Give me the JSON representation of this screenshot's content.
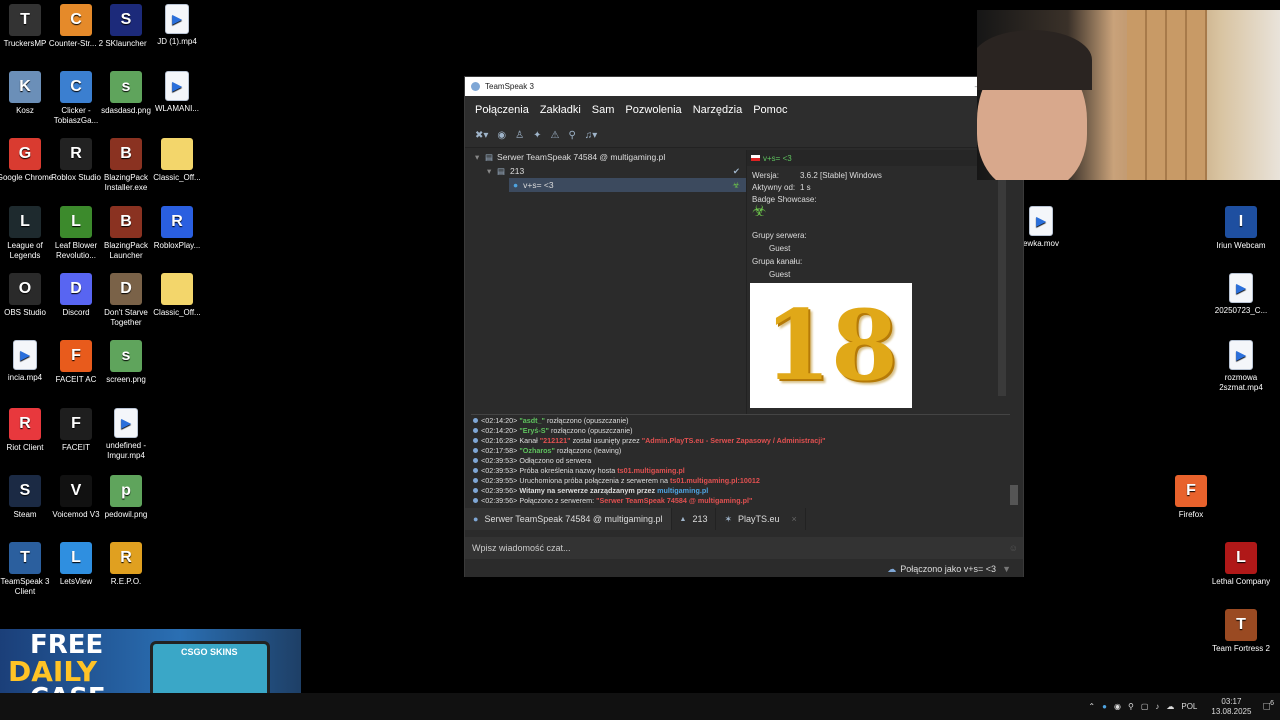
{
  "desktop_icons": [
    {
      "label": "TruckersMP",
      "icon": "truckersmp-icon",
      "color": "#333"
    },
    {
      "label": "Counter-Str... 2",
      "icon": "counter-strike-icon",
      "color": "#e58a2a"
    },
    {
      "label": "SKlauncher",
      "icon": "sklauncher-icon",
      "color": "#1c2a7a"
    },
    {
      "label": "JD (1).mp4",
      "icon": "video-file-icon",
      "color": ""
    },
    {
      "label": "Kosz",
      "icon": "recycle-bin-icon",
      "color": "#6b8fb8"
    },
    {
      "label": "Clicker - TobiaszGa...",
      "icon": "shortcut-icon",
      "color": "#3b7fd0"
    },
    {
      "label": "sdasdasd.png",
      "icon": "image-file-icon",
      "color": "#5fa45c"
    },
    {
      "label": "WLAMANI...",
      "icon": "video-file-icon",
      "color": ""
    },
    {
      "label": "Google Chrome",
      "icon": "chrome-icon",
      "color": "#d93b30"
    },
    {
      "label": "Roblox Studio",
      "icon": "roblox-studio-icon",
      "color": "#222"
    },
    {
      "label": "BlazingPack Installer.exe",
      "icon": "blazingpack-icon",
      "color": "#8a3221"
    },
    {
      "label": "Classic_Off...",
      "icon": "zip-folder-icon",
      "color": ""
    },
    {
      "label": "League of Legends",
      "icon": "league-icon",
      "color": "#1e2a2e"
    },
    {
      "label": "Leaf Blower Revolutio...",
      "icon": "leaf-blower-icon",
      "color": "#3c8a2c"
    },
    {
      "label": "BlazingPack Launcher",
      "icon": "blazingpack-icon",
      "color": "#8a3221"
    },
    {
      "label": "RobloxPlay...",
      "icon": "roblox-player-icon",
      "color": "#2a5fe0"
    },
    {
      "label": "OBS Studio",
      "icon": "obs-icon",
      "color": "#2a2a2a"
    },
    {
      "label": "Discord",
      "icon": "discord-icon",
      "color": "#5865f2"
    },
    {
      "label": "Don't Starve Together",
      "icon": "dont-starve-icon",
      "color": "#7a6248"
    },
    {
      "label": "Classic_Off...",
      "icon": "folder-icon",
      "color": ""
    },
    {
      "label": "incia.mp4",
      "icon": "video-file-icon",
      "color": ""
    },
    {
      "label": "FACEIT AC",
      "icon": "faceit-ac-icon",
      "color": "#e85b1c"
    },
    {
      "label": "screen.png",
      "icon": "image-file-icon",
      "color": "#5fa45c"
    },
    {
      "label": "Riot Client",
      "icon": "riot-client-icon",
      "color": "#e8383d"
    },
    {
      "label": "FACEIT",
      "icon": "faceit-icon",
      "color": "#1e1e1e"
    },
    {
      "label": "undefined - Imgur.mp4",
      "icon": "video-file-icon",
      "color": ""
    },
    {
      "label": "Steam",
      "icon": "steam-icon",
      "color": "#1b2a44"
    },
    {
      "label": "Voicemod V3",
      "icon": "voicemod-icon",
      "color": "#111"
    },
    {
      "label": "pedowil.png",
      "icon": "image-file-icon",
      "color": "#5fa45c"
    },
    {
      "label": "TeamSpeak 3 Client",
      "icon": "teamspeak-icon",
      "color": "#2b5f9e"
    },
    {
      "label": "LetsView",
      "icon": "letsview-icon",
      "color": "#2f8fe0"
    },
    {
      "label": "R.E.P.O.",
      "icon": "repo-icon",
      "color": "#e0a020"
    },
    {
      "label": "ewka.mov",
      "icon": "video-file-icon",
      "color": ""
    },
    {
      "label": "Iriun Webcam",
      "icon": "iriun-icon",
      "color": "#1e4fa0"
    },
    {
      "label": "20250723_C...",
      "icon": "video-file-icon",
      "color": ""
    },
    {
      "label": "rozmowa 2szmat.mp4",
      "icon": "video-file-icon",
      "color": ""
    },
    {
      "label": "Firefox",
      "icon": "firefox-icon",
      "color": "#e8622c"
    },
    {
      "label": "Lethal Company",
      "icon": "lethal-company-icon",
      "color": "#b01818"
    },
    {
      "label": "Team Fortress 2",
      "icon": "tf2-icon",
      "color": "#9a4a22"
    }
  ],
  "teamspeak": {
    "title": "TeamSpeak 3",
    "menu": [
      "Połączenia",
      "Zakładki",
      "Sam",
      "Pozwolenia",
      "Narzędzia",
      "Pomoc"
    ],
    "tree": {
      "server": "Serwer TeamSpeak 74584 @ multigaming.pl",
      "channel": "213",
      "client": "v+s= <3"
    },
    "info": {
      "nickname": "v+s= <3",
      "version_label": "Wersja:",
      "version_value": "3.6.2 [Stable] Windows",
      "active_label": "Aktywny od:",
      "active_value": "1 s",
      "badge_label": "Badge Showcase:",
      "server_groups_label": "Grupy serwera:",
      "server_group": "Guest",
      "channel_group_label": "Grupa kanału:",
      "channel_group": "Guest",
      "avatar_text": "18"
    },
    "log": [
      {
        "time": "<02:14:20>",
        "pre": "",
        "hi": "\"asdt_\"",
        "hiclass": "g",
        "post": " rozłączono (opuszczanie)"
      },
      {
        "time": "<02:14:20>",
        "pre": "",
        "hi": "\"Eryś-S\"",
        "hiclass": "g",
        "post": " rozłączono (opuszczanie)"
      },
      {
        "time": "<02:16:28>",
        "pre": "Kanał ",
        "hi": "\"212121\"",
        "hiclass": "r",
        "post": " został usunięty przez ",
        "hi2": "\"Admin.PlayTS.eu - Serwer Zapasowy / Administracji\"",
        "hi2class": "r"
      },
      {
        "time": "<02:17:58>",
        "pre": "",
        "hi": "\"Ozharos\"",
        "hiclass": "g",
        "post": " rozłączono (leaving)"
      },
      {
        "time": "<02:39:53>",
        "pre": "Odłączono od serwera",
        "hi": "",
        "hiclass": "",
        "post": ""
      },
      {
        "time": "<02:39:53>",
        "pre": "Próba określenia nazwy hosta ",
        "hi": "ts01.multigaming.pl",
        "hiclass": "r",
        "post": ""
      },
      {
        "time": "<02:39:55>",
        "pre": "Uruchomiona próba połączenia z serwerem na ",
        "hi": "ts01.multigaming.pl:10012",
        "hiclass": "r",
        "post": ""
      },
      {
        "time": "<02:39:56>",
        "pre": "Witamy na serwerze zarządzanym przez ",
        "hi": "multigaming.pl",
        "hiclass": "bl",
        "post": "",
        "bold": true
      },
      {
        "time": "<02:39:56>",
        "pre": "Połączono z serwerem: ",
        "hi": "\"Serwer TeamSpeak 74584 @ multigaming.pl\"",
        "hiclass": "r",
        "post": ""
      }
    ],
    "tabs": [
      "Serwer TeamSpeak 74584 @ multigaming.pl",
      "213",
      "PlayTS.eu"
    ],
    "chat_placeholder": "Wpisz wiadomość czat...",
    "status": "Połączono jako v+s= <3"
  },
  "banner": {
    "line1": "FREE",
    "line2": "DAILY",
    "line3": "CASE",
    "brand": "CSGO SKINS"
  },
  "taskbar": {
    "lang": "POL",
    "time": "03:17",
    "date": "13.08.2025",
    "notifications": "6"
  }
}
